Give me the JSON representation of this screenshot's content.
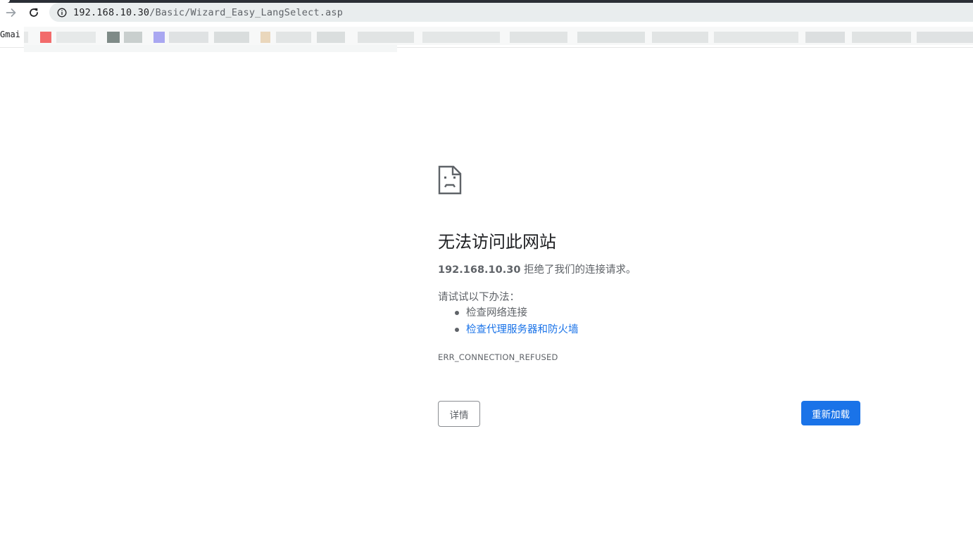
{
  "browser": {
    "url_host": "192.168.10.30",
    "url_path": "/Basic/Wizard_Easy_LangSelect.asp",
    "bookmarks": {
      "first_label": "Gmai"
    },
    "icons": {
      "forward": "arrow-forward-icon",
      "reload": "reload-icon",
      "site_info": "info-icon"
    }
  },
  "error": {
    "icon": "sad-document-icon",
    "heading": "无法访问此网站",
    "summary_host": "192.168.10.30",
    "summary_text": " 拒绝了我们的连接请求。",
    "suggestions_title": "请试试以下办法：",
    "suggestions": [
      {
        "label": "检查网络连接",
        "is_link": false
      },
      {
        "label": "检查代理服务器和防火墙",
        "is_link": true
      }
    ],
    "code": "ERR_CONNECTION_REFUSED",
    "details_button": "详情",
    "reload_button": "重新加载"
  },
  "colors": {
    "accent": "#1a73e8",
    "text_primary": "#202124",
    "text_secondary": "#5f6368",
    "omnibox_bg": "#e9edee"
  }
}
